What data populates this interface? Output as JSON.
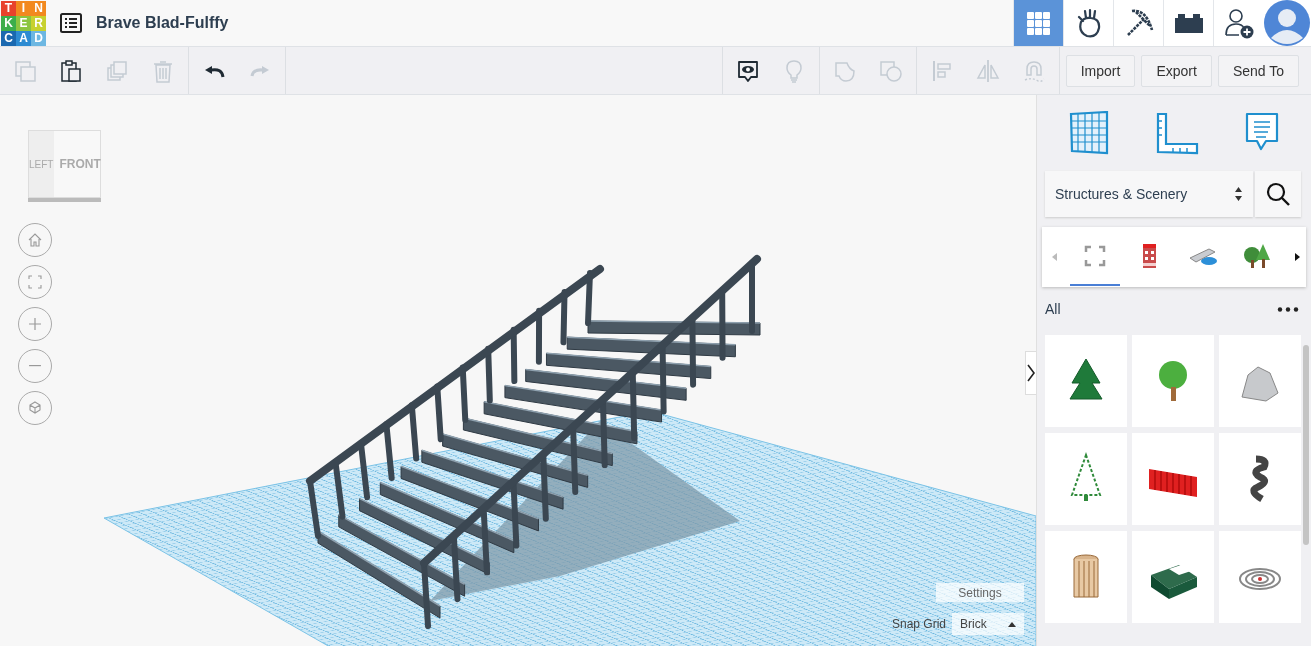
{
  "logo": [
    {
      "letter": "T",
      "color": "#e8412c"
    },
    {
      "letter": "I",
      "color": "#f2891f"
    },
    {
      "letter": "N",
      "color": "#f2891f"
    },
    {
      "letter": "K",
      "color": "#3cae4b"
    },
    {
      "letter": "E",
      "color": "#8cc540"
    },
    {
      "letter": "R",
      "color": "#c7d12f"
    },
    {
      "letter": "C",
      "color": "#1a68b0"
    },
    {
      "letter": "A",
      "color": "#2d8bd2"
    },
    {
      "letter": "D",
      "color": "#6db7e2"
    }
  ],
  "title": "Brave Blad-Fulffy",
  "header_apps": [
    {
      "selected": true
    },
    {
      "selected": false
    },
    {
      "selected": false
    },
    {
      "selected": false
    },
    {
      "selected": false
    }
  ],
  "toolbar": {
    "groups": [
      [
        {
          "disabled": true
        },
        {
          "disabled": false
        },
        {
          "disabled": true
        },
        {
          "disabled": true
        }
      ],
      [
        {
          "disabled": false
        },
        {
          "disabled": true
        }
      ],
      [
        {
          "disabled": false
        },
        {
          "disabled": true
        }
      ],
      [
        {
          "disabled": true
        },
        {
          "disabled": true
        }
      ],
      [
        {
          "disabled": true
        },
        {
          "disabled": true
        },
        {
          "disabled": true
        }
      ]
    ],
    "buttons": [
      "Import",
      "Export",
      "Send To"
    ]
  },
  "view_cube": {
    "left": "LEFT",
    "front": "FRONT"
  },
  "panel": {
    "category": "Structures & Scenery",
    "category_tabs": [
      {
        "selected": true
      },
      {
        "selected": false
      },
      {
        "selected": false
      },
      {
        "selected": false
      }
    ],
    "section": "All"
  },
  "settings_button": "Settings",
  "snap_grid": {
    "label": "Snap Grid",
    "value": "Brick"
  }
}
